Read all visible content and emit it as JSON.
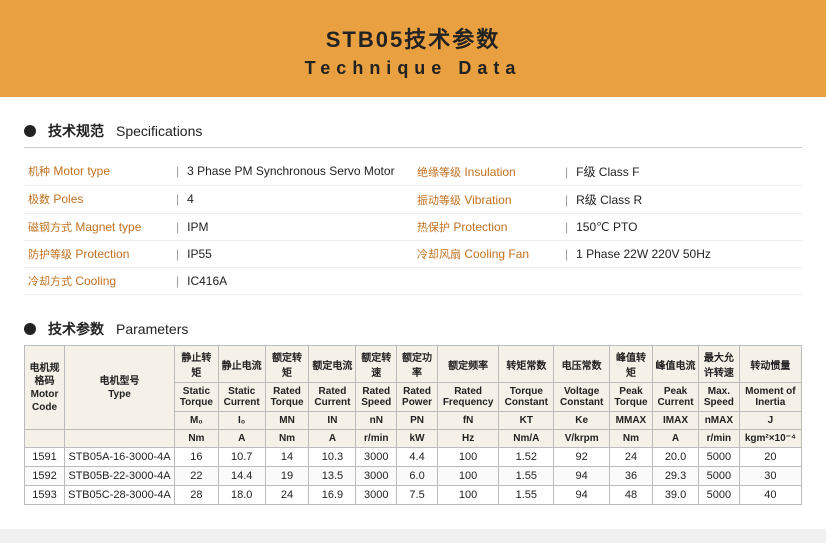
{
  "header": {
    "title_cn": "STB05技术参数",
    "title_en": "Technique  Data"
  },
  "specs_section": {
    "bullet": true,
    "title_cn": "技术规范",
    "title_en": "Specifications",
    "rows": [
      {
        "label_cn": "机种",
        "label_en": "Motor type",
        "value": "3 Phase PM Synchronous Servo Motor",
        "col": 0
      },
      {
        "label_cn": "绝缘等级",
        "label_en": "Insulation",
        "value": "F级  Class F",
        "col": 1
      },
      {
        "label_cn": "极数",
        "label_en": "Poles",
        "value": "4",
        "col": 0
      },
      {
        "label_cn": "振动等级",
        "label_en": "Vibration",
        "value": "R级  Class R",
        "col": 1
      },
      {
        "label_cn": "磁钢方式",
        "label_en": "Magnet type",
        "value": "IPM",
        "col": 0
      },
      {
        "label_cn": "热保护",
        "label_en": "Protection",
        "value": "150℃ PTO",
        "col": 1
      },
      {
        "label_cn": "防护等级",
        "label_en": "Protection",
        "value": "IP55",
        "col": 0
      },
      {
        "label_cn": "冷却风扇",
        "label_en": "Cooling Fan",
        "value": "1 Phase  22W  220V  50Hz",
        "col": 1
      },
      {
        "label_cn": "冷却方式",
        "label_en": "Cooling",
        "value": "IC416A",
        "col": 0
      }
    ]
  },
  "params_section": {
    "bullet": true,
    "title_cn": "技术参数",
    "title_en": "Parameters",
    "columns": [
      {
        "cn": "电机规格码",
        "en": "Motor Code"
      },
      {
        "cn": "电机型号",
        "en": "Type"
      },
      {
        "cn": "静止转矩",
        "en": "Static Torque",
        "sym": "M₀",
        "unit": "Nm"
      },
      {
        "cn": "静止电流",
        "en": "Static Current",
        "sym": "I₀",
        "unit": "A"
      },
      {
        "cn": "额定转矩",
        "en": "Rated Torque",
        "sym": "MN",
        "unit": "Nm"
      },
      {
        "cn": "额定电流",
        "en": "Rated Current",
        "sym": "IN",
        "unit": "A"
      },
      {
        "cn": "额定转速",
        "en": "Rated Speed",
        "sym": "nN",
        "unit": "r/min"
      },
      {
        "cn": "额定功率",
        "en": "Rated Power",
        "sym": "PN",
        "unit": "kW"
      },
      {
        "cn": "额定频率",
        "en": "Rated Frequency",
        "sym": "fN",
        "unit": "Hz"
      },
      {
        "cn": "转矩常数",
        "en": "Torque Constant",
        "sym": "KT",
        "unit": "Nm/A"
      },
      {
        "cn": "电压常数",
        "en": "Voltage Constant",
        "sym": "Ke",
        "unit": "V/krpm"
      },
      {
        "cn": "峰值转矩",
        "en": "Peak Torque",
        "sym": "MMAX",
        "unit": "Nm"
      },
      {
        "cn": "峰值电流",
        "en": "Peak Current",
        "sym": "IMAX",
        "unit": "A"
      },
      {
        "cn": "最大允许转速",
        "en": "Max. Speed",
        "sym": "nMAX",
        "unit": "r/min"
      },
      {
        "cn": "转动惯量",
        "en": "Moment of Inertia",
        "sym": "J",
        "unit": "kgm²×10⁻⁴"
      }
    ],
    "data": [
      {
        "code": "1591",
        "type": "STB05A-16-3000-4A",
        "vals": [
          "16",
          "10.7",
          "14",
          "10.3",
          "3000",
          "4.4",
          "100",
          "1.52",
          "92",
          "24",
          "20.0",
          "5000",
          "20"
        ]
      },
      {
        "code": "1592",
        "type": "STB05B-22-3000-4A",
        "vals": [
          "22",
          "14.4",
          "19",
          "13.5",
          "3000",
          "6.0",
          "100",
          "1.55",
          "94",
          "36",
          "29.3",
          "5000",
          "30"
        ]
      },
      {
        "code": "1593",
        "type": "STB05C-28-3000-4A",
        "vals": [
          "28",
          "18.0",
          "24",
          "16.9",
          "3000",
          "7.5",
          "100",
          "1.55",
          "94",
          "48",
          "39.0",
          "5000",
          "40"
        ]
      }
    ]
  }
}
